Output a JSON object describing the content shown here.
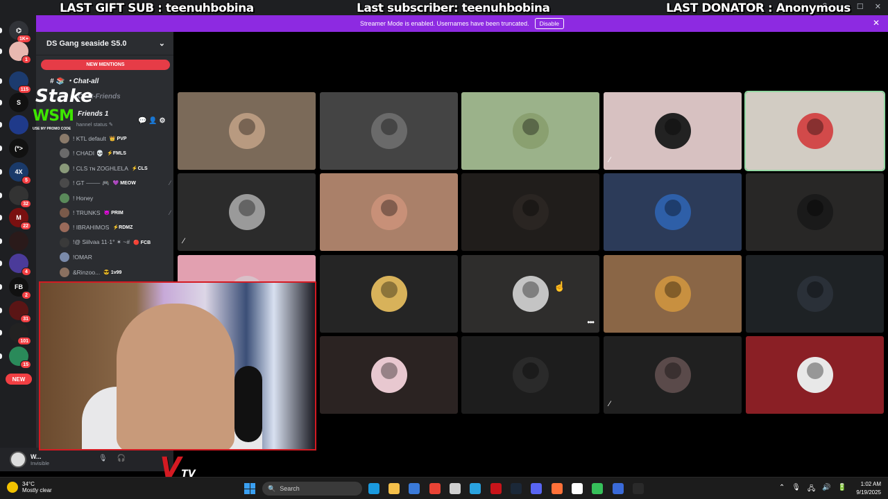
{
  "overlay": {
    "last_gift_sub": "LAST GIFT SUB : teenuhbobina",
    "last_subscriber": "Last subscriber: teenuhbobina",
    "last_donator": "LAST DONATOR : Anonymous",
    "stake_text": "Stake",
    "wsm_text": "WSM",
    "wsm_subtext": "USE MY PROMO CODE",
    "tv_logo_letter": "V",
    "tv_logo_suffix": "TV"
  },
  "banner": {
    "text": "Streamer Mode is enabled. Usernames have been truncated.",
    "disable_label": "Disable",
    "close_glyph": "✕"
  },
  "title_controls": {
    "help": "?",
    "minimize": "—",
    "maximize": "☐",
    "close": "✕"
  },
  "server_rail": {
    "items": [
      {
        "badge": "1K+",
        "color": "#313338",
        "glyph": "⌬"
      },
      {
        "badge": "1",
        "color": "#e8b8b0",
        "glyph": ""
      },
      {
        "badge": "115",
        "color": "#1c3b6e",
        "glyph": ""
      },
      {
        "badge": "",
        "color": "#111111",
        "glyph": "S"
      },
      {
        "badge": "",
        "color": "#1f3a8a",
        "glyph": ""
      },
      {
        "badge": "",
        "color": "#111111",
        "glyph": "(*>"
      },
      {
        "badge": "5",
        "color": "#1a3a6a",
        "glyph": "4X"
      },
      {
        "badge": "32",
        "color": "#333333",
        "glyph": ""
      },
      {
        "badge": "22",
        "color": "#7a1010",
        "glyph": "M"
      },
      {
        "badge": "",
        "color": "#2a1a1a",
        "glyph": ""
      },
      {
        "badge": "4",
        "color": "#4b3b9a",
        "glyph": ""
      },
      {
        "badge": "2",
        "color": "#111111",
        "glyph": "FB"
      },
      {
        "badge": "31",
        "color": "#5a1515",
        "glyph": ""
      },
      {
        "badge": "101",
        "color": "#222222",
        "glyph": ""
      },
      {
        "badge": "15",
        "color": "#2a8a5a",
        "glyph": ""
      }
    ],
    "new_label": "NEW"
  },
  "sidebar": {
    "server_name": "DS Gang seaside S5.0",
    "chevron": "⌄",
    "new_mentions": "NEW MENTIONS",
    "channels": [
      {
        "name": "# 📚 ・Chat-all",
        "muted": false
      },
      {
        "name": "Chat-Friends",
        "muted": true
      },
      {
        "name": "Friends 1",
        "muted": false
      }
    ],
    "channel_status": "hannel status ✎",
    "voice_members": [
      {
        "name": "! KTL default",
        "tag": "👑 PVP",
        "muted": false,
        "avatar_color": "#8a7a6a"
      },
      {
        "name": "! CHADI 💀",
        "tag": "⚡FMLS",
        "muted": false,
        "avatar_color": "#6a6a6a"
      },
      {
        "name": "! CLS ᴛɴ ZOGHLELA",
        "tag": "⚡CLS",
        "muted": false,
        "avatar_color": "#8a9a7a"
      },
      {
        "name": "! GT ⸻ 🎮",
        "tag": "💜 MEOW",
        "muted": true,
        "avatar_color": "#4a4a4a"
      },
      {
        "name": "! Honey",
        "tag": "",
        "muted": false,
        "avatar_color": "#5a8a5a"
      },
      {
        "name": "! TRUNKS",
        "tag": "😈 PRIM",
        "muted": true,
        "avatar_color": "#7a5a4a"
      },
      {
        "name": "! IBRAHIMOS",
        "tag": "⚡RDMZ",
        "muted": false,
        "avatar_color": "#9a6a5a"
      },
      {
        "name": "!@ Siilvaa 11·1° ✶ ~#",
        "tag": "🔴 FCB",
        "muted": false,
        "avatar_color": "#3a3a3a"
      },
      {
        "name": "!OMAR",
        "tag": "",
        "muted": false,
        "avatar_color": "#7a8aaa"
      },
      {
        "name": "&Rinzoo...",
        "tag": "😎 1v99",
        "muted": false,
        "avatar_color": "#8a7060"
      }
    ]
  },
  "user_panel": {
    "name": "W...",
    "status": "Invisible",
    "mic_icon": "🎙",
    "headset_icon": "🎧"
  },
  "voice_tiles": [
    {
      "bg": "#7b6a59",
      "avatar": "#b89a80",
      "muted": false,
      "active": false,
      "more": false
    },
    {
      "bg": "#444444",
      "avatar": "#6a6a6a",
      "muted": false,
      "active": false,
      "more": false
    },
    {
      "bg": "#9bb28a",
      "avatar": "#8aa070",
      "muted": false,
      "active": false,
      "more": false
    },
    {
      "bg": "#d7c1c1",
      "avatar": "#222222",
      "muted": true,
      "active": false,
      "more": false
    },
    {
      "bg": "#d2ccc3",
      "avatar": "#d24a4a",
      "muted": false,
      "active": true,
      "more": false
    },
    {
      "bg": "#2b2b2b",
      "avatar": "#9a9a9a",
      "muted": true,
      "active": false,
      "more": false
    },
    {
      "bg": "#aa8069",
      "avatar": "#c89078",
      "muted": false,
      "active": false,
      "more": false
    },
    {
      "bg": "#201d1b",
      "avatar": "#2a2522",
      "muted": false,
      "active": false,
      "more": false
    },
    {
      "bg": "#2c3b59",
      "avatar": "#2e5fa8",
      "muted": false,
      "active": false,
      "more": false
    },
    {
      "bg": "#282726",
      "avatar": "#1a1a1a",
      "muted": false,
      "active": false,
      "more": false
    },
    {
      "bg": "#e2a0b0",
      "avatar": "#d8c0c8",
      "muted": false,
      "active": false,
      "more": false
    },
    {
      "bg": "#252525",
      "avatar": "#d8b25a",
      "muted": false,
      "active": false,
      "more": false
    },
    {
      "bg": "#2e2d2c",
      "avatar": "#c4c4c4",
      "muted": false,
      "active": false,
      "more": true
    },
    {
      "bg": "#8a6646",
      "avatar": "#c89040",
      "muted": false,
      "active": false,
      "more": false
    },
    {
      "bg": "#1e2225",
      "avatar": "#2a3038",
      "muted": false,
      "active": false,
      "more": false
    },
    {
      "bg": "#1a1a1a",
      "avatar": "#1a1a1a",
      "muted": false,
      "active": false,
      "more": false
    },
    {
      "bg": "#2b2322",
      "avatar": "#e8c8d0",
      "muted": false,
      "active": false,
      "more": false
    },
    {
      "bg": "#1d1d1d",
      "avatar": "#2a2a2a",
      "muted": false,
      "active": false,
      "more": false
    },
    {
      "bg": "#202020",
      "avatar": "#5a4a4a",
      "muted": true,
      "active": false,
      "more": false
    },
    {
      "bg": "#8a1f25",
      "avatar": "#e8e8e8",
      "muted": false,
      "active": false,
      "more": false
    }
  ],
  "taskbar": {
    "weather_temp": "34°C",
    "weather_desc": "Mostly clear",
    "search_placeholder": "Search",
    "search_icon": "🔍",
    "apps": [
      {
        "name": "edge",
        "color": "#1a9adf"
      },
      {
        "name": "explorer",
        "color": "#f5c04a"
      },
      {
        "name": "store",
        "color": "#3a7ad8"
      },
      {
        "name": "chrome",
        "color": "#e94335"
      },
      {
        "name": "app5",
        "color": "#cfcfcf"
      },
      {
        "name": "telegram",
        "color": "#2aa3e0"
      },
      {
        "name": "app7",
        "color": "#c8141a"
      },
      {
        "name": "steam",
        "color": "#1b2838"
      },
      {
        "name": "discord",
        "color": "#5865f2"
      },
      {
        "name": "firefox",
        "color": "#ff7139"
      },
      {
        "name": "app11",
        "color": "#ffffff"
      },
      {
        "name": "app12",
        "color": "#36c05a"
      },
      {
        "name": "app13",
        "color": "#3a6ad8"
      },
      {
        "name": "epic",
        "color": "#2a2a2a"
      }
    ],
    "tray_icons": [
      "⌃",
      "🎙",
      "🖧",
      "🔊",
      "🔋"
    ],
    "time": "1:02 AM",
    "date": "9/19/2025"
  }
}
